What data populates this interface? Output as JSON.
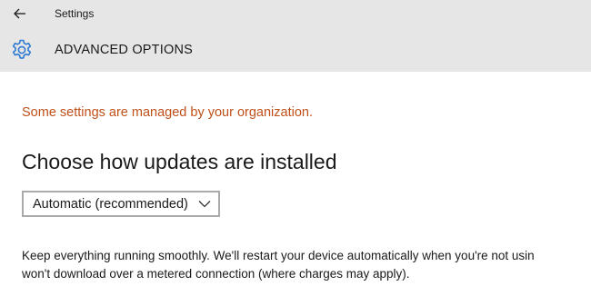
{
  "window": {
    "app_title": "Settings",
    "back_icon": "back-arrow-icon"
  },
  "header": {
    "icon": "gear-icon",
    "page_title": "ADVANCED OPTIONS",
    "accent_color": "#2d7ad2"
  },
  "main": {
    "managed_notice": "Some settings are managed by your organization.",
    "notice_color": "#c0501a",
    "section_heading": "Choose how updates are installed",
    "update_dropdown": {
      "selected": "Automatic (recommended)"
    },
    "description_lines": [
      "Keep everything running smoothly. We'll restart your device automatically when you're not usin",
      "won't download over a metered connection (where charges may apply)."
    ]
  }
}
